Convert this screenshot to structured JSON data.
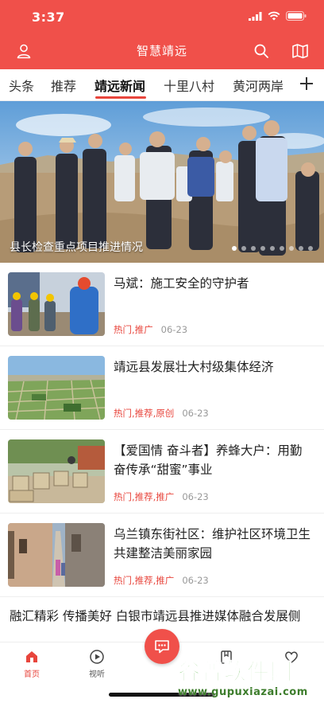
{
  "status": {
    "time": "3:37"
  },
  "app": {
    "title": "智慧靖远",
    "accent": "#f0504a"
  },
  "tabs": [
    {
      "label": "头条"
    },
    {
      "label": "推荐"
    },
    {
      "label": "靖远新闻",
      "active": true
    },
    {
      "label": "十里八村"
    },
    {
      "label": "黄河两岸"
    }
  ],
  "banner": {
    "caption": "县长检查重点项目推进情况",
    "slide_count": 9,
    "active_slide": 1
  },
  "news": [
    {
      "title": "马斌：施工安全的守护者",
      "tags": "热门,推广",
      "date": "06-23"
    },
    {
      "title": "靖远县发展壮大村级集体经济",
      "tags": "热门,推荐,原创",
      "date": "06-23"
    },
    {
      "title": "【爱国情 奋斗者】养蜂大户：用勤奋传承“甜蜜”事业",
      "tags": "热门,推荐,推广",
      "date": "06-23"
    },
    {
      "title": "乌兰镇东街社区：维护社区环境卫生 共建整洁美丽家园",
      "tags": "热门,推荐,推广",
      "date": "06-23"
    }
  ],
  "text_news": {
    "title": "融汇精彩 传播美好 白银市靖远县推进媒体融合发展侧"
  },
  "bottom_nav": {
    "home": "首页",
    "video": "视听"
  },
  "watermark": {
    "line1": "谷普软件园",
    "line2": "www.gupuxiazai.com"
  }
}
